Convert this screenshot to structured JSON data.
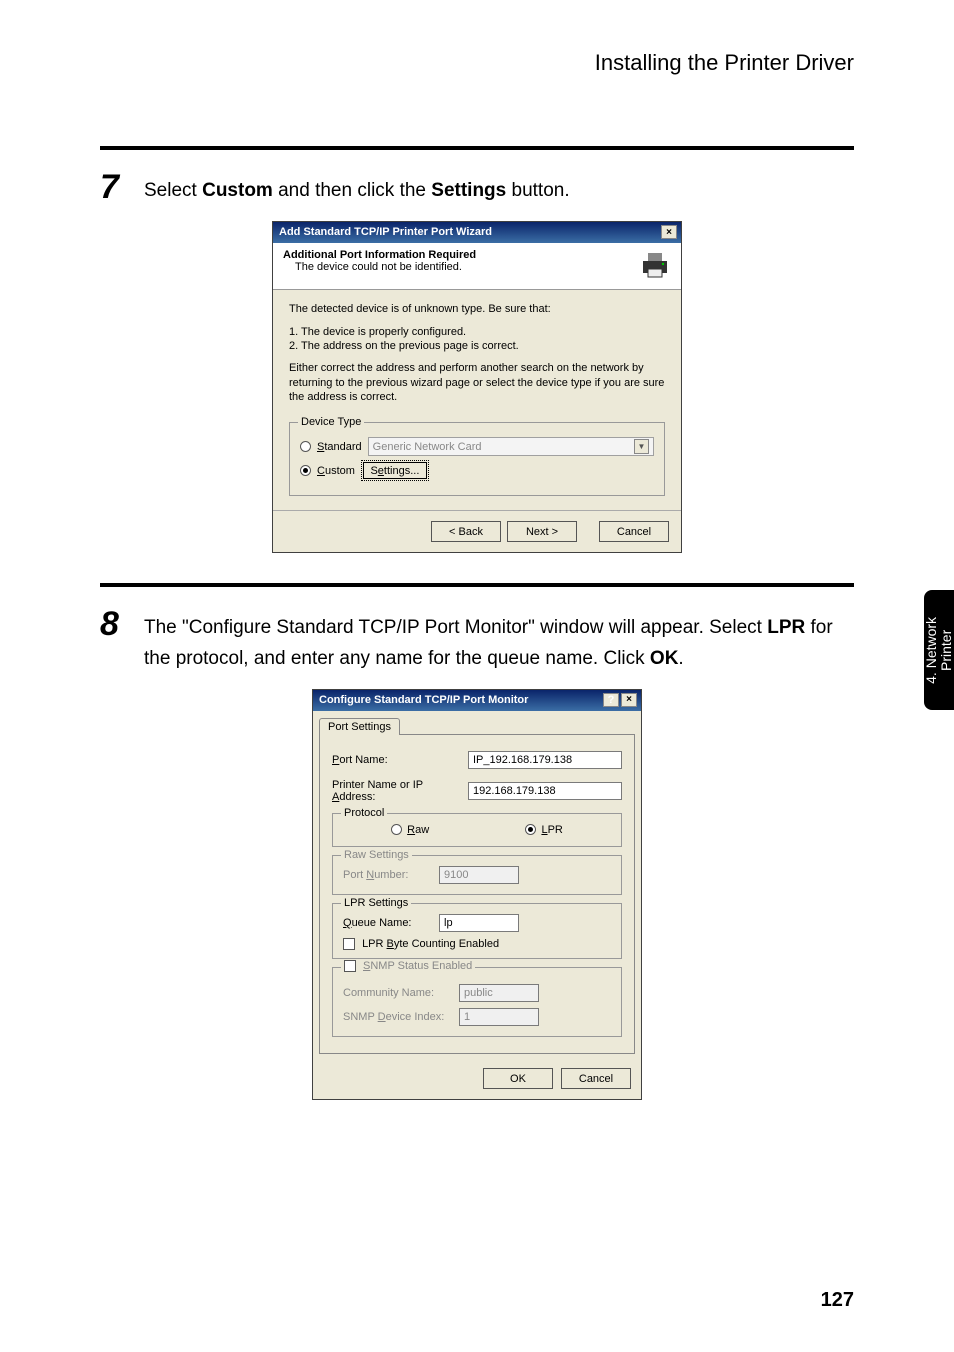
{
  "header": {
    "title": "Installing the Printer Driver"
  },
  "sidetab": {
    "line1": "4. Network",
    "line2": "Printer"
  },
  "page_number": "127",
  "steps": {
    "s7": {
      "num": "7",
      "pre": "Select ",
      "b1": "Custom",
      "mid": " and then click the ",
      "b2": "Settings",
      "post": " button."
    },
    "s8": {
      "num": "8",
      "pre": "The \"Configure Standard TCP/IP Port Monitor\" window will appear.  Select ",
      "b1": "LPR",
      "mid": " for the protocol, and enter any name for the queue name.  Click ",
      "b2": "OK",
      "post": "."
    }
  },
  "dlg1": {
    "title": "Add Standard TCP/IP Printer Port Wizard",
    "head_title": "Additional Port Information Required",
    "head_sub": "The device could not be identified.",
    "body_l1": "The detected device is of unknown type.  Be sure that:",
    "body_l2": "1.  The device is properly configured.",
    "body_l3": "2.  The address on the previous page is correct.",
    "body_l4": "Either correct the address and perform another search on the network by returning to the previous wizard page or select the device type if you are sure the address is correct.",
    "device_type_legend": "Device Type",
    "radio_standard": "Standard",
    "standard_value": "Generic Network Card",
    "radio_custom": "Custom",
    "settings_btn": "Settings...",
    "back": "< Back",
    "next": "Next >",
    "cancel": "Cancel"
  },
  "dlg2": {
    "title": "Configure Standard TCP/IP Port Monitor",
    "tab": "Port Settings",
    "port_name_label": "Port Name:",
    "port_name_value": "IP_192.168.179.138",
    "printer_label": "Printer Name or IP Address:",
    "printer_value": "192.168.179.138",
    "protocol_legend": "Protocol",
    "raw_label": "Raw",
    "lpr_label": "LPR",
    "raw_settings_legend": "Raw Settings",
    "port_number_label": "Port Number:",
    "port_number_value": "9100",
    "lpr_settings_legend": "LPR Settings",
    "queue_label": "Queue Name:",
    "queue_value": "lp",
    "lpr_byte_label": "LPR Byte Counting Enabled",
    "snmp_legend": "SNMP Status Enabled",
    "community_label": "Community Name:",
    "community_value": "public",
    "snmp_index_label": "SNMP Device Index:",
    "snmp_index_value": "1",
    "ok": "OK",
    "cancel": "Cancel"
  }
}
